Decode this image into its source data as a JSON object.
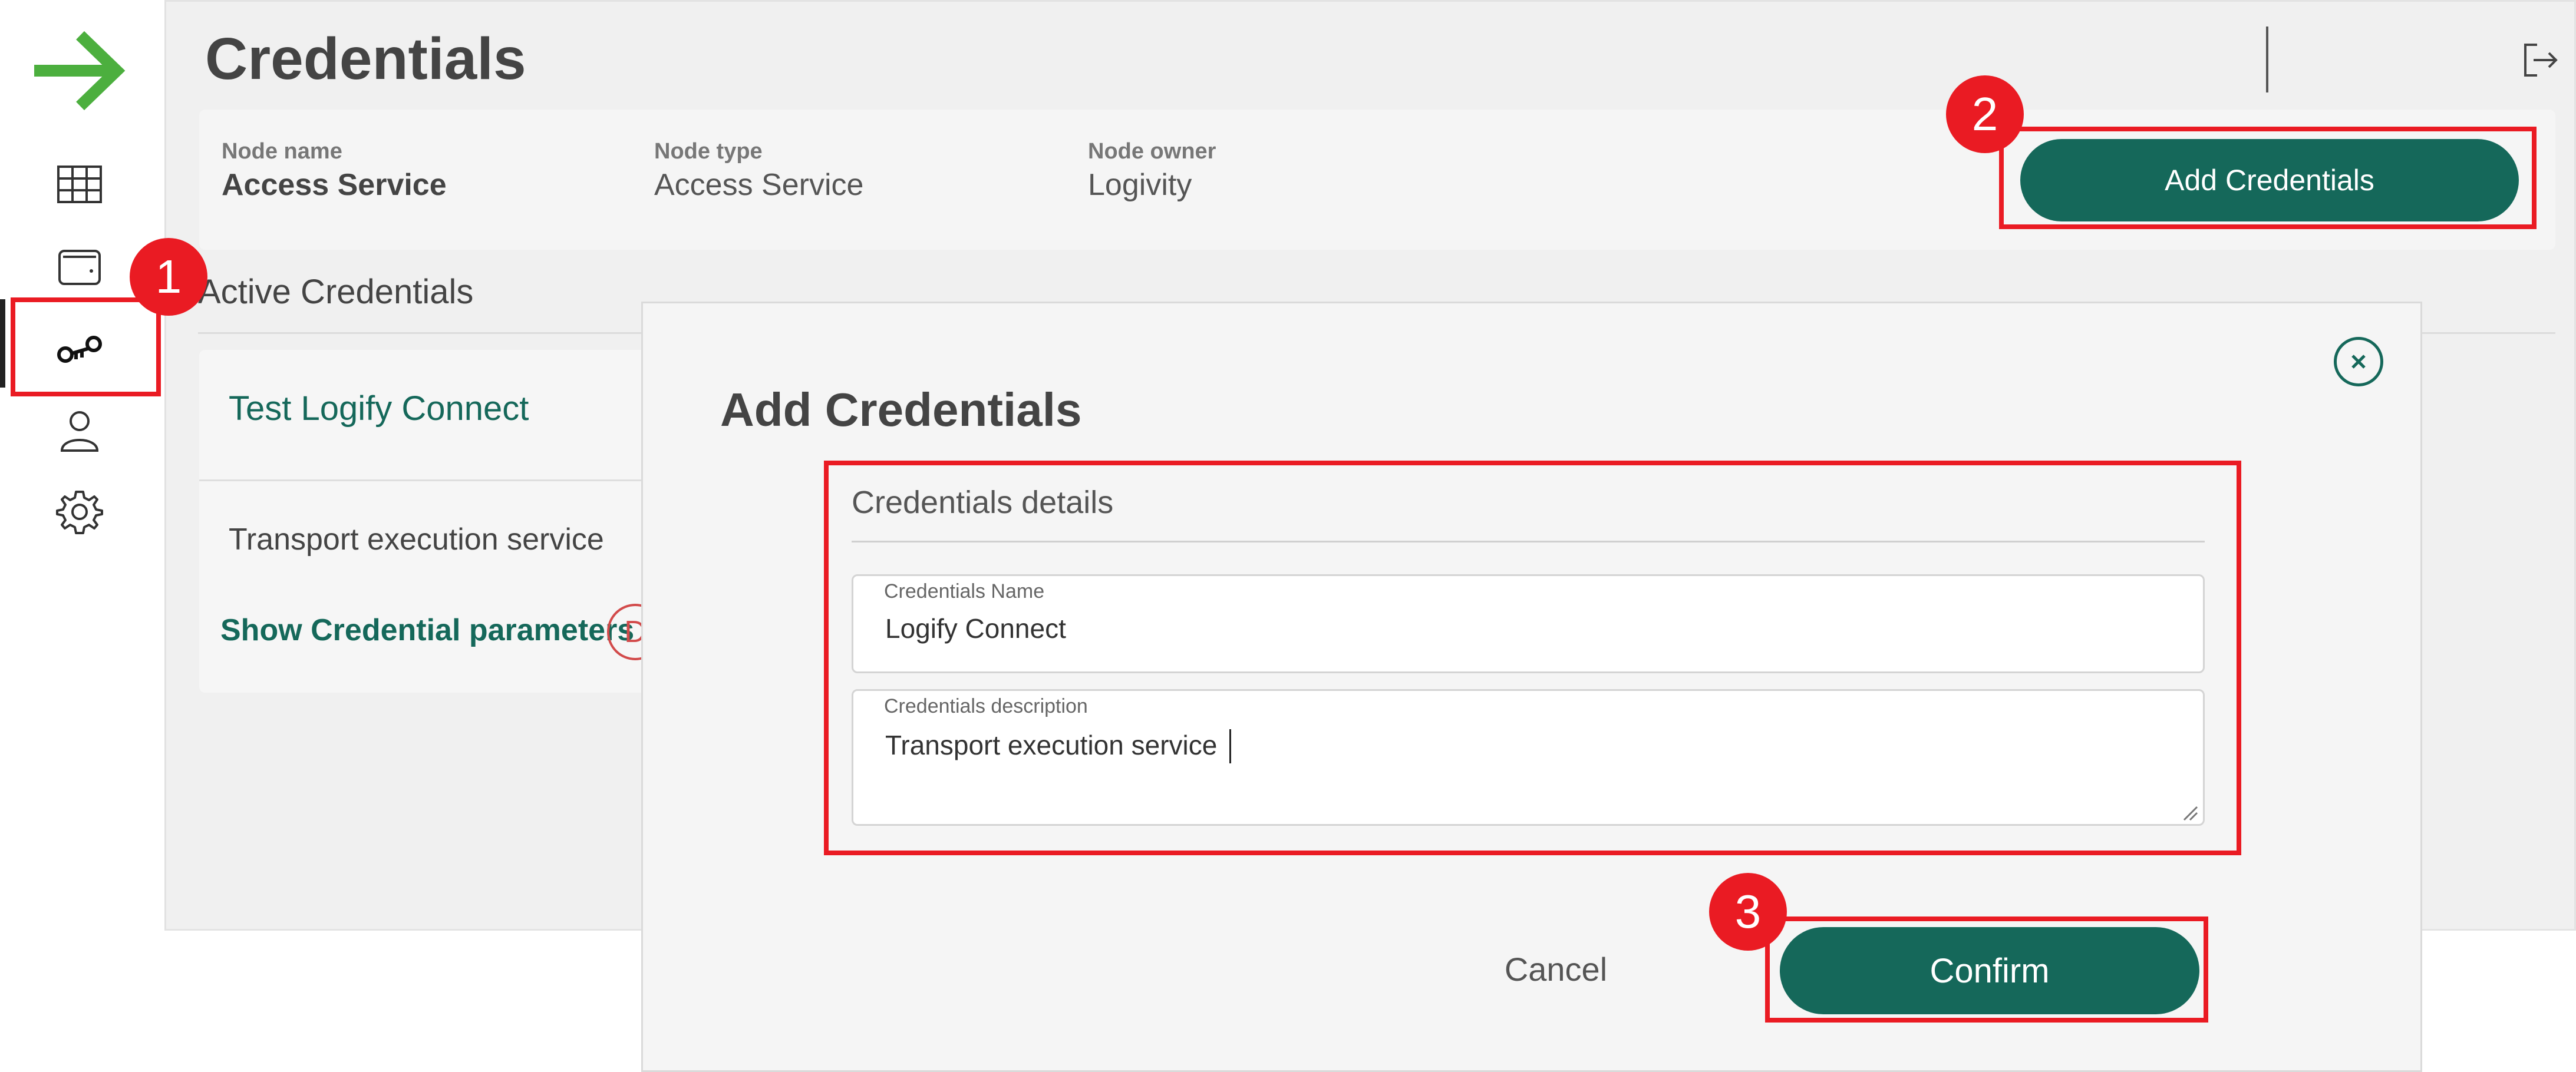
{
  "page": {
    "title": "Credentials"
  },
  "node_info": {
    "fields": [
      {
        "label": "Node name",
        "value": "Access Service"
      },
      {
        "label": "Node type",
        "value": "Access Service"
      },
      {
        "label": "Node owner",
        "value": "Logivity"
      }
    ],
    "add_button_label": "Add Credentials"
  },
  "active_credentials": {
    "heading": "Active Credentials",
    "card": {
      "title": "Test Logify Connect",
      "description": "Transport execution service",
      "show_params_label": "Show Credential parameters",
      "delete_badge": "D"
    }
  },
  "modal": {
    "title": "Add Credentials",
    "section_heading": "Credentials details",
    "name_field": {
      "label": "Credentials Name",
      "value": "Logify Connect"
    },
    "description_field": {
      "label": "Credentials description",
      "value": "Transport execution service"
    },
    "cancel_label": "Cancel",
    "confirm_label": "Confirm"
  },
  "annotations": {
    "steps": [
      "1",
      "2",
      "3"
    ],
    "color": "#ea1b23"
  },
  "sidebar": {
    "items": [
      {
        "icon": "table-icon"
      },
      {
        "icon": "wallet-icon"
      },
      {
        "icon": "keys-icon",
        "active": true
      },
      {
        "icon": "user-icon"
      },
      {
        "icon": "gear-icon"
      }
    ]
  },
  "colors": {
    "accent": "#15685a",
    "logo": "#4caf3e"
  }
}
